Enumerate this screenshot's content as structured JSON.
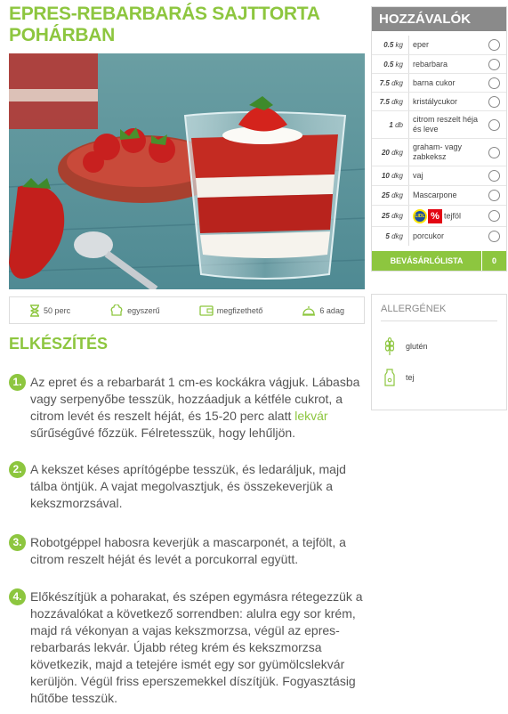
{
  "recipe": {
    "title": "EPRES-REBARBARÁS SAJTTORTA POHÁRBAN"
  },
  "info": {
    "time": "50 perc",
    "difficulty": "egyszerű",
    "cost": "megfizethető",
    "servings": "6 adag"
  },
  "preparation": {
    "heading": "ELKÉSZÍTÉS",
    "steps": [
      {
        "num": "1.",
        "before": "Az epret és a rebarbarát 1 cm-es kockákra vágjuk. Lábasba vagy serpenyőbe tesszük, hozzáadjuk a kétféle cukrot, a citrom levét és reszelt héját, és 15-20 perc alatt ",
        "link": "lekvár",
        "after": " sűrűségűvé főzzük. Félretesszük, hogy lehűljön."
      },
      {
        "num": "2.",
        "text": "A kekszet késes aprítógépbe tesszük, és ledaráljuk, majd tálba öntjük. A vajat megolvasztjuk, és összekeverjük a kekszmorzsával."
      },
      {
        "num": "3.",
        "text": "Robotgéppel habosra keverjük a mascarponét, a tejfölt, a citrom reszelt héját és levét a porcukorral együtt."
      },
      {
        "num": "4.",
        "text": "Előkészítjük a poharakat, és szépen egymásra rétegezzük a hozzávalókat a következő sorrendben: alulra egy sor krém, majd rá vékonyan a vajas kekszmorzsa, végül az epres-rebarbarás lekvár. Újabb réteg krém és kekszmorzsa következik, majd a tetejére ismét egy sor gyümölcslekvár kerüljön. Végül friss eperszemekkel díszítjük. Fogyasztásig hűtőbe tesszük."
      }
    ]
  },
  "ingredients": {
    "heading": "HOZZÁVALÓK",
    "items": [
      {
        "amount": "0.5",
        "unit": "kg",
        "name": "eper"
      },
      {
        "amount": "0.5",
        "unit": "kg",
        "name": "rebarbara"
      },
      {
        "amount": "7.5",
        "unit": "dkg",
        "name": "barna cukor"
      },
      {
        "amount": "7.5",
        "unit": "dkg",
        "name": "kristálycukor"
      },
      {
        "amount": "1",
        "unit": "db",
        "name": "citrom reszelt héja és leve"
      },
      {
        "amount": "20",
        "unit": "dkg",
        "name": "graham- vagy zabkeksz"
      },
      {
        "amount": "10",
        "unit": "dkg",
        "name": "vaj"
      },
      {
        "amount": "25",
        "unit": "dkg",
        "name": "Mascarpone"
      },
      {
        "amount": "25",
        "unit": "dkg",
        "name": "tejföl",
        "lidl": true
      },
      {
        "amount": "5",
        "unit": "dkg",
        "name": "porcukor"
      }
    ],
    "lidl_logo_text": "LIDL",
    "lidl_percent": "%",
    "shopping_list_label": "BEVÁSÁRLÓLISTA",
    "shopping_list_count": "0"
  },
  "allergens": {
    "heading": "ALLERGÉNEK",
    "items": [
      {
        "name": "glutén",
        "icon": "wheat-icon"
      },
      {
        "name": "tej",
        "icon": "milk-icon"
      }
    ]
  },
  "colors": {
    "accent": "#8dc63f",
    "panel_header": "#8a8a8a",
    "lidl_red": "#e30613",
    "lidl_blue": "#1a4fa0"
  }
}
